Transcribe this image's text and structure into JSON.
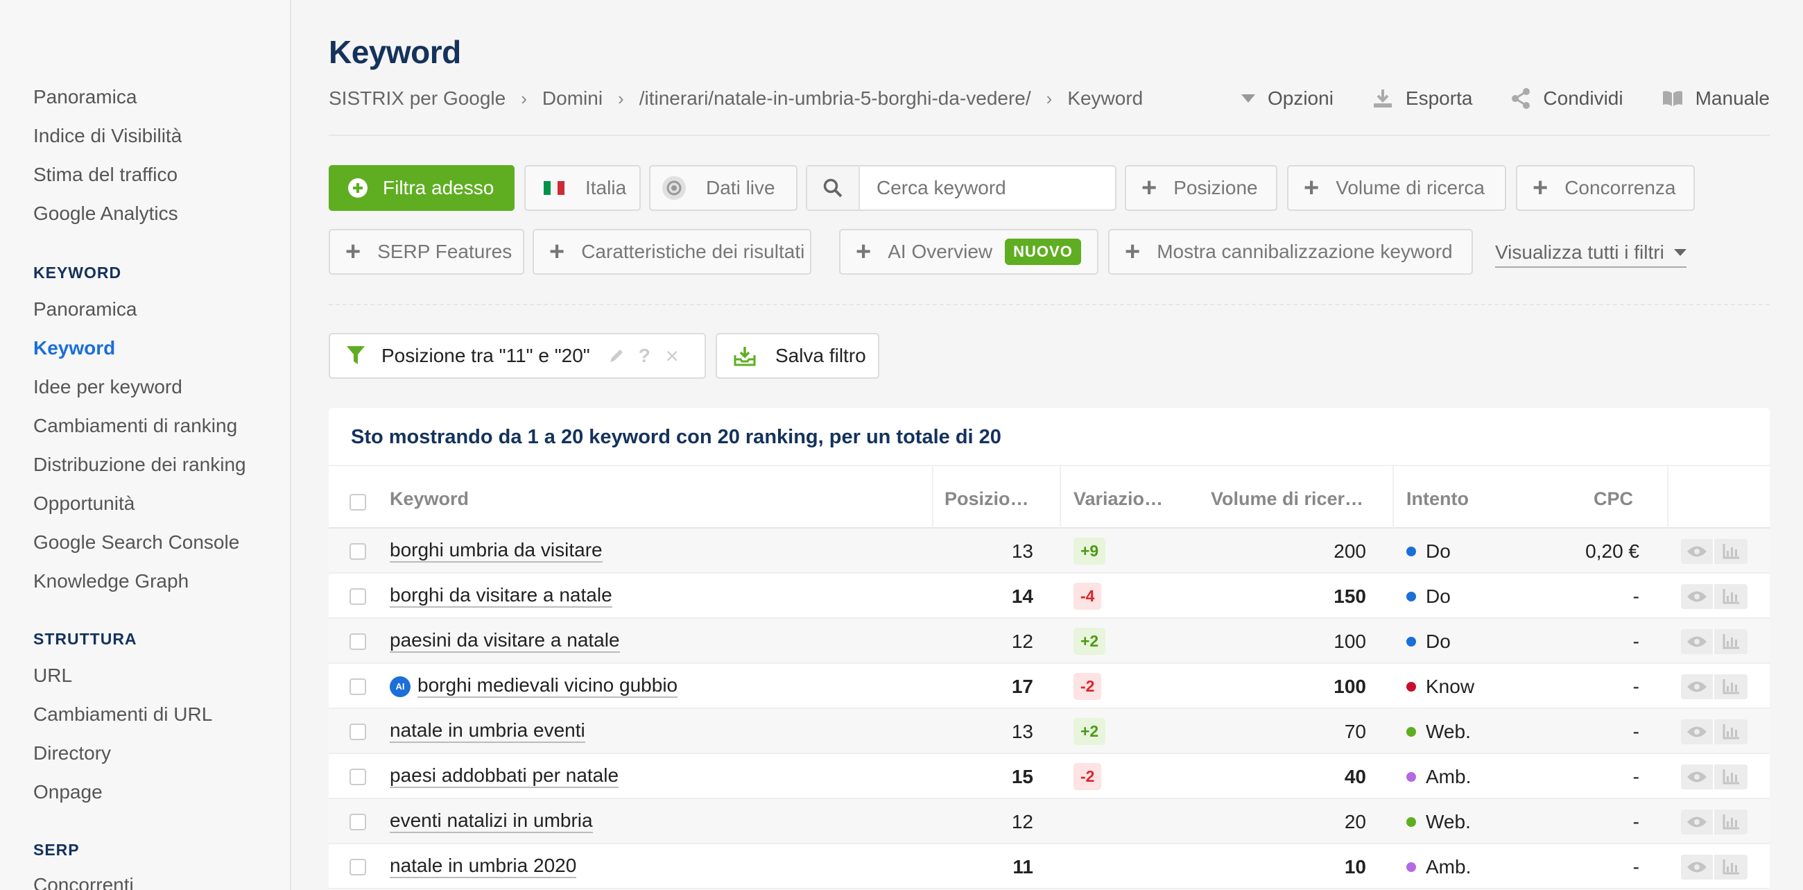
{
  "sidebar": {
    "top_items": [
      "Panoramica",
      "Indice di Visibilità",
      "Stima del traffico",
      "Google Analytics"
    ],
    "sections": [
      {
        "title": "KEYWORD",
        "items": [
          "Panoramica",
          "Keyword",
          "Idee per keyword",
          "Cambiamenti di ranking",
          "Distribuzione dei ranking",
          "Opportunità",
          "Google Search Console",
          "Knowledge Graph"
        ],
        "active": "Keyword"
      },
      {
        "title": "STRUTTURA",
        "items": [
          "URL",
          "Cambiamenti di URL",
          "Directory",
          "Onpage"
        ]
      },
      {
        "title": "SERP",
        "items": [
          "Concorrenti"
        ]
      }
    ]
  },
  "page": {
    "title": "Keyword",
    "breadcrumb": [
      "SISTRIX per Google",
      "Domini",
      "/itinerari/natale-in-umbria-5-borghi-da-vedere/",
      "Keyword"
    ]
  },
  "actions": {
    "options": "Opzioni",
    "export": "Esporta",
    "share": "Condividi",
    "manual": "Manuale"
  },
  "filters": {
    "filter_now": "Filtra adesso",
    "country": "Italia",
    "live_data": "Dati live",
    "search_placeholder": "Cerca keyword",
    "position": "Posizione",
    "search_volume": "Volume di ricerca",
    "competition": "Concorrenza",
    "serp_features": "SERP Features",
    "result_features": "Caratteristiche dei risultati",
    "ai_overview": "AI Overview",
    "new_badge": "NUOVO",
    "cannibalization": "Mostra cannibalizzazione keyword",
    "show_all": "Visualizza tutti i filtri",
    "active_filter": "Posizione tra \"11\" e \"20\"",
    "save_filter": "Salva filtro"
  },
  "colors": {
    "brand_green": "#5fae21",
    "navy": "#14325c",
    "link_blue": "#1a6fd8"
  },
  "table": {
    "summary": "Sto mostrando da 1 a 20 keyword con 20 ranking, per un totale di 20",
    "headers": {
      "keyword": "Keyword",
      "position": "Posizio…",
      "change": "Variazio…",
      "volume": "Volume di ricer…",
      "intent": "Intento",
      "cpc": "CPC"
    },
    "rows": [
      {
        "keyword": "borghi umbria da visitare",
        "position": "13",
        "change": "+9",
        "dir": "up",
        "volume": "200",
        "intent": "Do",
        "intent_color": "#1a6fd8",
        "cpc": "0,20 €",
        "ai": false,
        "bold": false
      },
      {
        "keyword": "borghi da visitare a natale",
        "position": "14",
        "change": "-4",
        "dir": "down",
        "volume": "150",
        "intent": "Do",
        "intent_color": "#1a6fd8",
        "cpc": "-",
        "ai": false,
        "bold": true
      },
      {
        "keyword": "paesini da visitare a natale",
        "position": "12",
        "change": "+2",
        "dir": "up",
        "volume": "100",
        "intent": "Do",
        "intent_color": "#1a6fd8",
        "cpc": "-",
        "ai": false,
        "bold": false
      },
      {
        "keyword": "borghi medievali vicino gubbio",
        "position": "17",
        "change": "-2",
        "dir": "down",
        "volume": "100",
        "intent": "Know",
        "intent_color": "#c8102e",
        "cpc": "-",
        "ai": true,
        "bold": true
      },
      {
        "keyword": "natale in umbria eventi",
        "position": "13",
        "change": "+2",
        "dir": "up",
        "volume": "70",
        "intent": "Web.",
        "intent_color": "#5fae21",
        "cpc": "-",
        "ai": false,
        "bold": false
      },
      {
        "keyword": "paesi addobbati per natale",
        "position": "15",
        "change": "-2",
        "dir": "down",
        "volume": "40",
        "intent": "Amb.",
        "intent_color": "#b36ae2",
        "cpc": "-",
        "ai": false,
        "bold": true
      },
      {
        "keyword": "eventi natalizi in umbria",
        "position": "12",
        "change": "",
        "dir": "",
        "volume": "20",
        "intent": "Web.",
        "intent_color": "#5fae21",
        "cpc": "-",
        "ai": false,
        "bold": false
      },
      {
        "keyword": "natale in umbria 2020",
        "position": "11",
        "change": "",
        "dir": "",
        "volume": "10",
        "intent": "Amb.",
        "intent_color": "#b36ae2",
        "cpc": "-",
        "ai": false,
        "bold": true
      }
    ]
  }
}
